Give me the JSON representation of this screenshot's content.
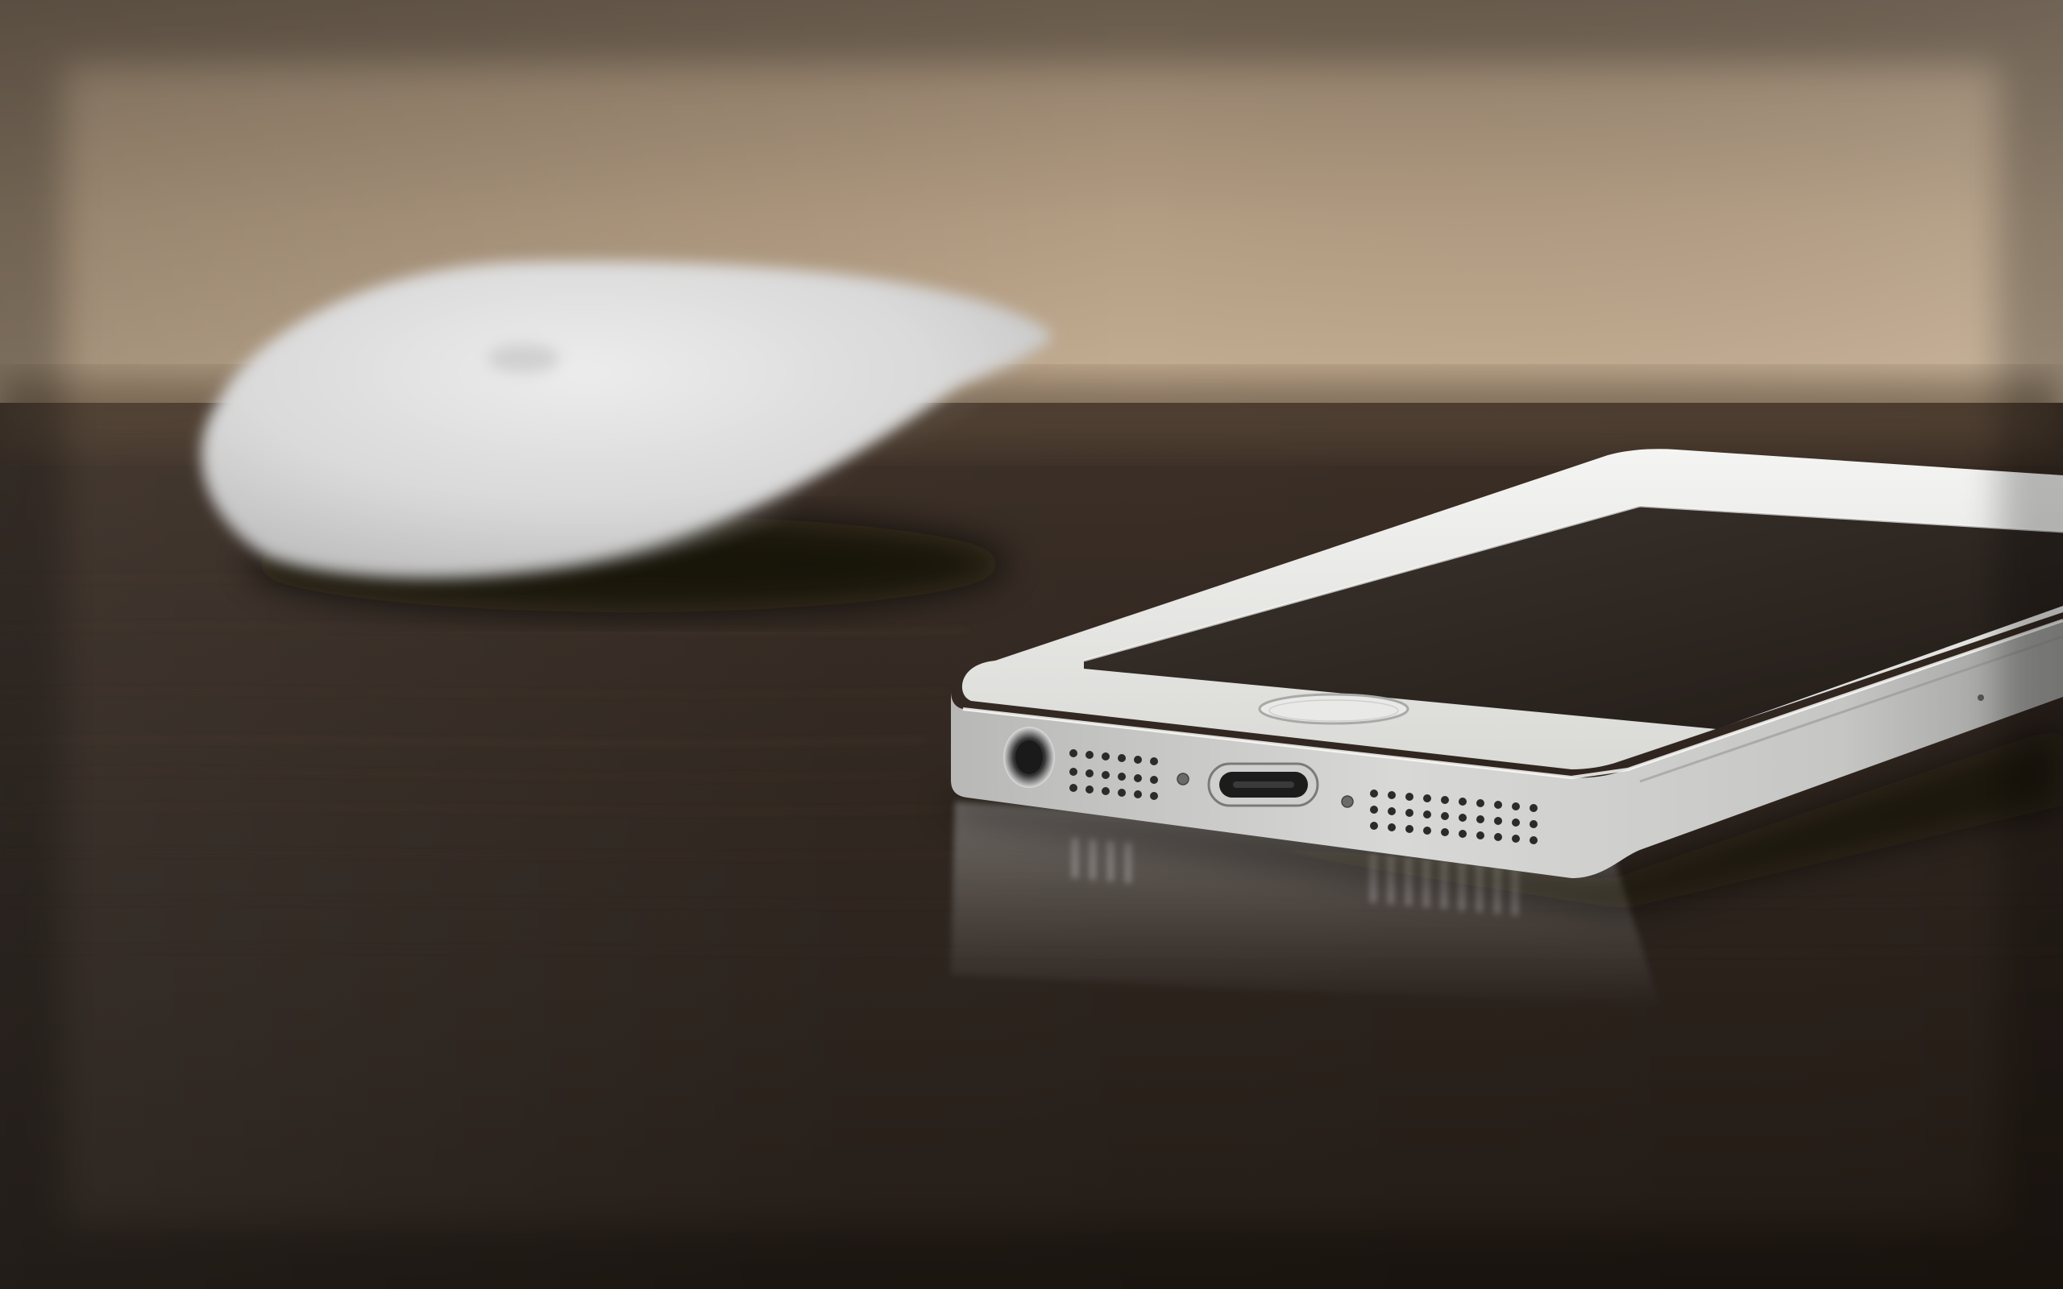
{
  "scene": {
    "subjects": [
      "computer-mouse",
      "smartphone"
    ],
    "palette": {
      "wall_top": "#8a7460",
      "wall_bottom": "#c8b398",
      "desk_far": "#3a2c22",
      "desk_near": "#231a14",
      "device_silver": "#e6e6e4",
      "device_shadow": "#a8a8a6",
      "screen_glass": "#2e2823",
      "mouse_white": "#dcdcdc"
    }
  }
}
